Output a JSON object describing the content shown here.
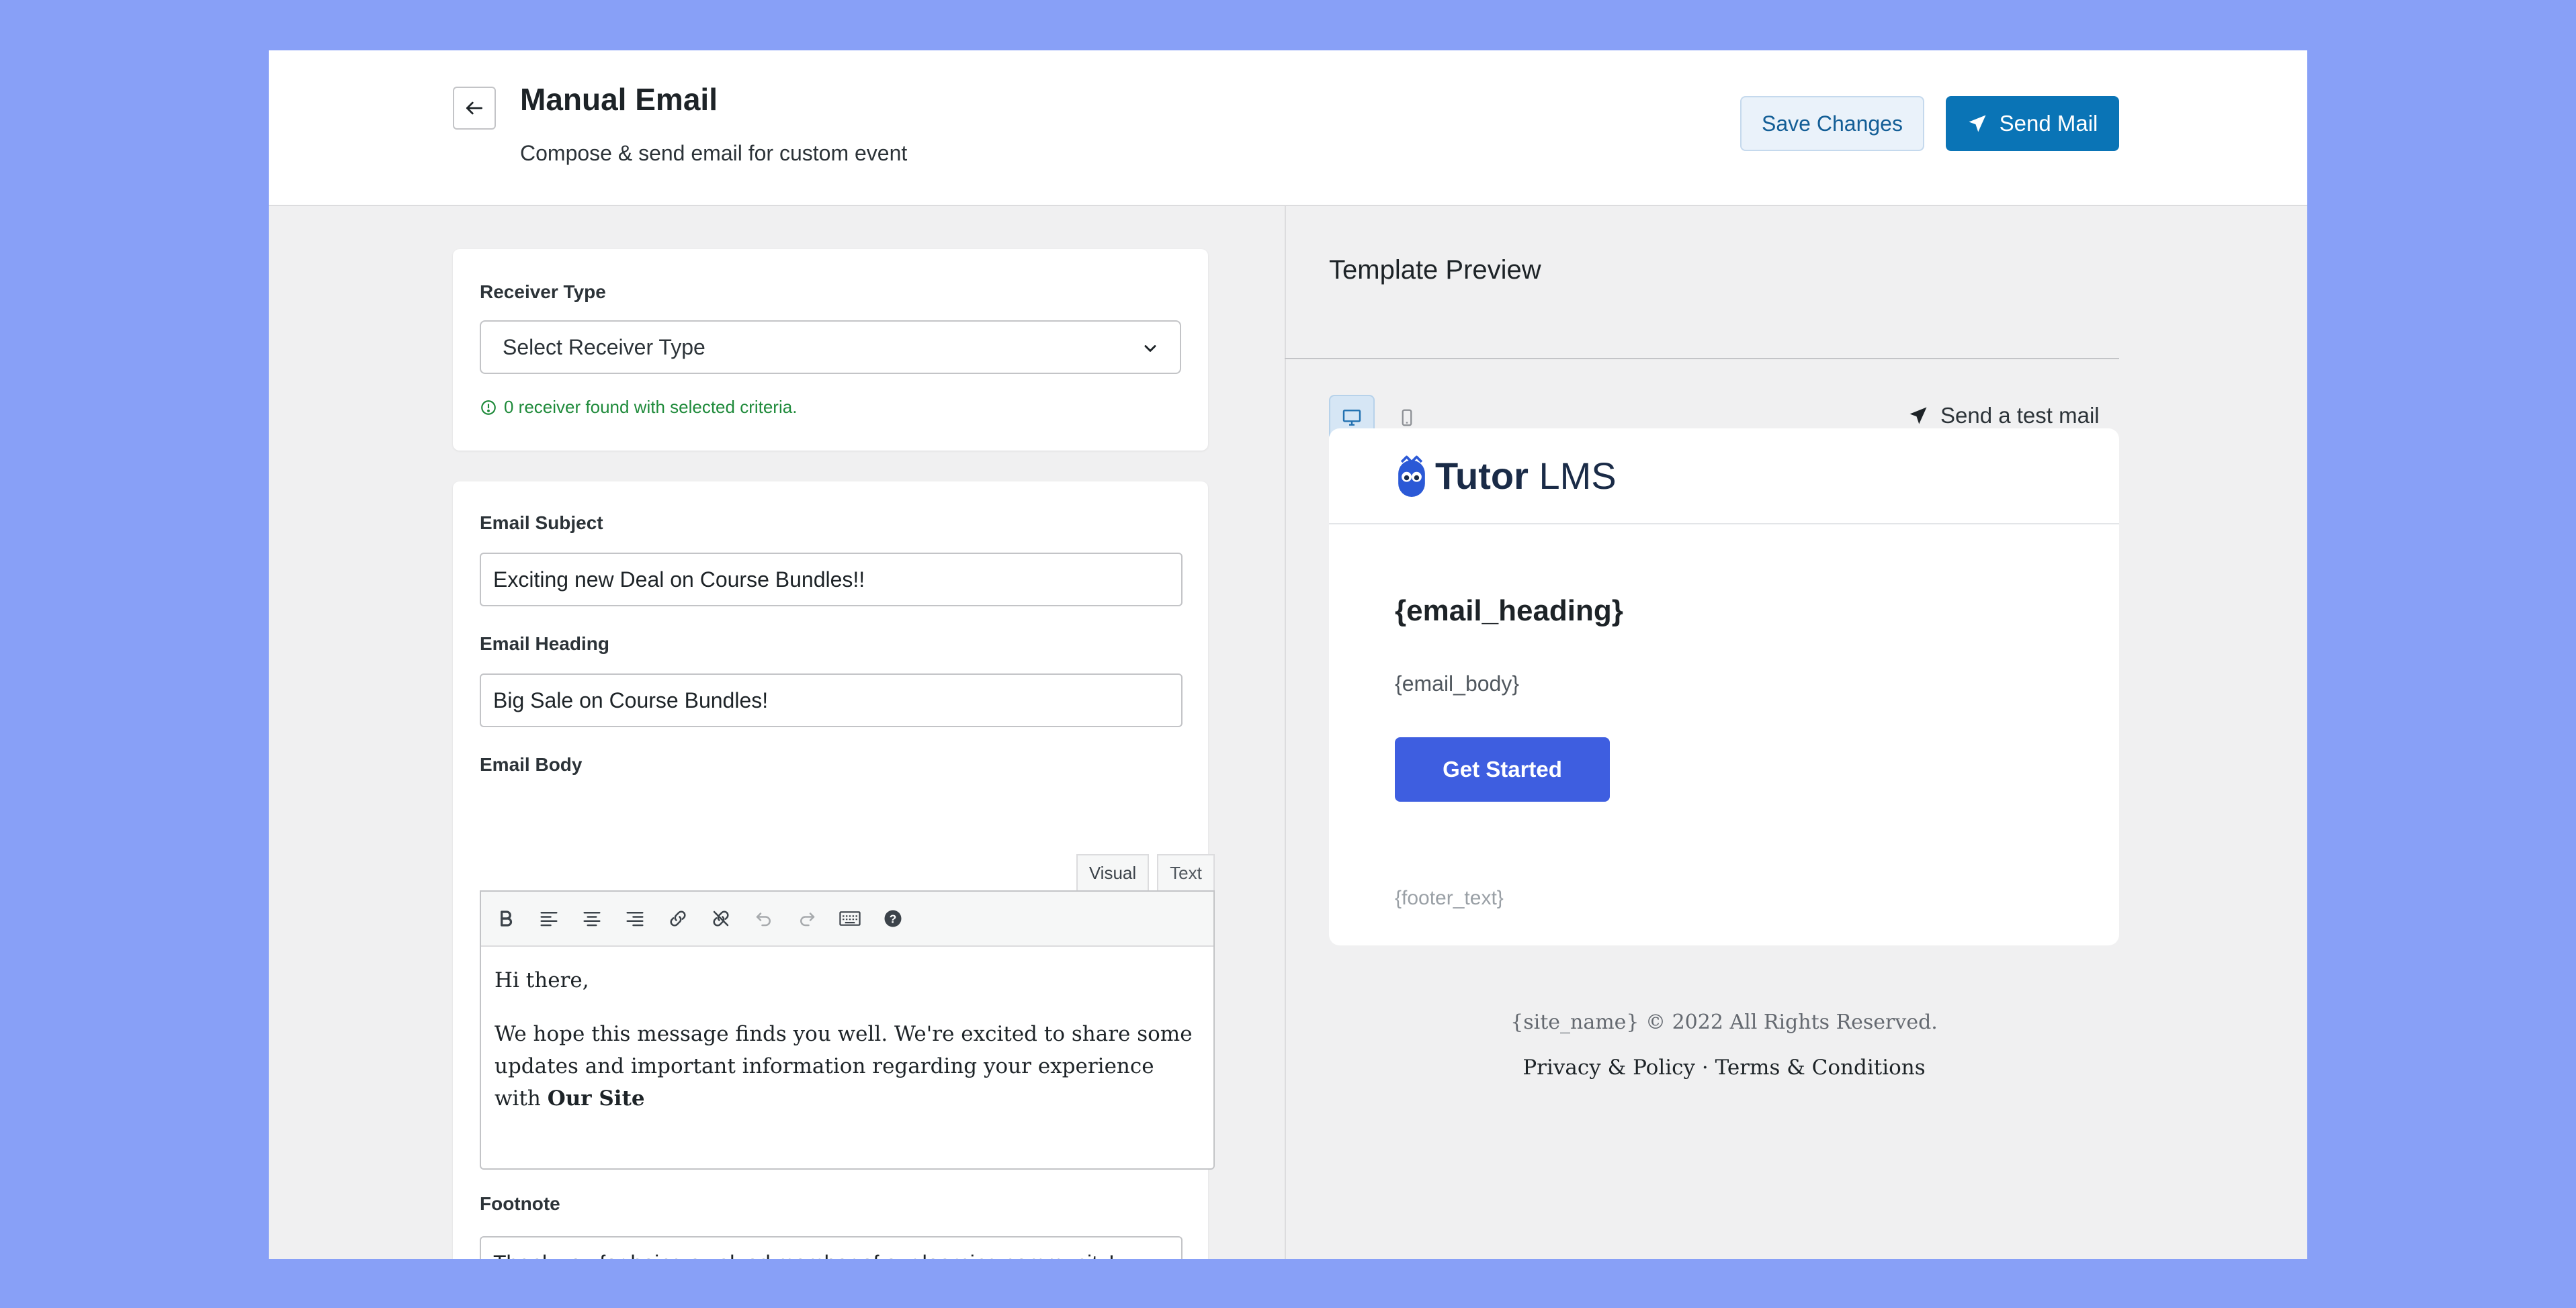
{
  "header": {
    "title": "Manual Email",
    "subtitle": "Compose & send email for custom event",
    "back_icon": "arrow-left-icon",
    "save_label": "Save Changes",
    "send_label": "Send Mail",
    "send_icon": "paper-plane-icon"
  },
  "receiver": {
    "label": "Receiver Type",
    "select_value": "Select Receiver Type",
    "hint": "0 receiver found with selected criteria."
  },
  "compose": {
    "subject_label": "Email Subject",
    "subject_value": "Exciting new Deal on Course Bundles!!",
    "heading_label": "Email Heading",
    "heading_value": "Big Sale on Course Bundles!",
    "body_label": "Email Body",
    "tab_visual": "Visual",
    "tab_text": "Text",
    "toolbar_icons": [
      "bold-icon",
      "align-left-icon",
      "align-center-icon",
      "align-right-icon",
      "link-icon",
      "unlink-icon",
      "undo-icon",
      "redo-icon",
      "keyboard-icon",
      "help-icon"
    ],
    "body_p1": "Hi there,",
    "body_p2_a": "We hope this message finds you well. We're excited to share some updates and important information regarding your experience with ",
    "body_p2_b": "Our Site",
    "footnote_label": "Footnote",
    "footnote_value": "Thank you for being a valued member of our learning community!"
  },
  "preview": {
    "title": "Template Preview",
    "test_mail_label": "Send a test mail",
    "logo_bold": "Tutor",
    "logo_light": " LMS",
    "email_heading": "{email_heading}",
    "email_body": "{email_body}",
    "cta_label": "Get Started",
    "footer_text": "{footer_text}",
    "copyright": "{site_name} © 2022 All Rights Reserved.",
    "legal": "Privacy & Policy · Terms & Conditions"
  },
  "colors": {
    "background": "#88a0f7",
    "primary": "#0a74b6",
    "cta": "#3e5ee0",
    "success": "#1e8a3a"
  }
}
